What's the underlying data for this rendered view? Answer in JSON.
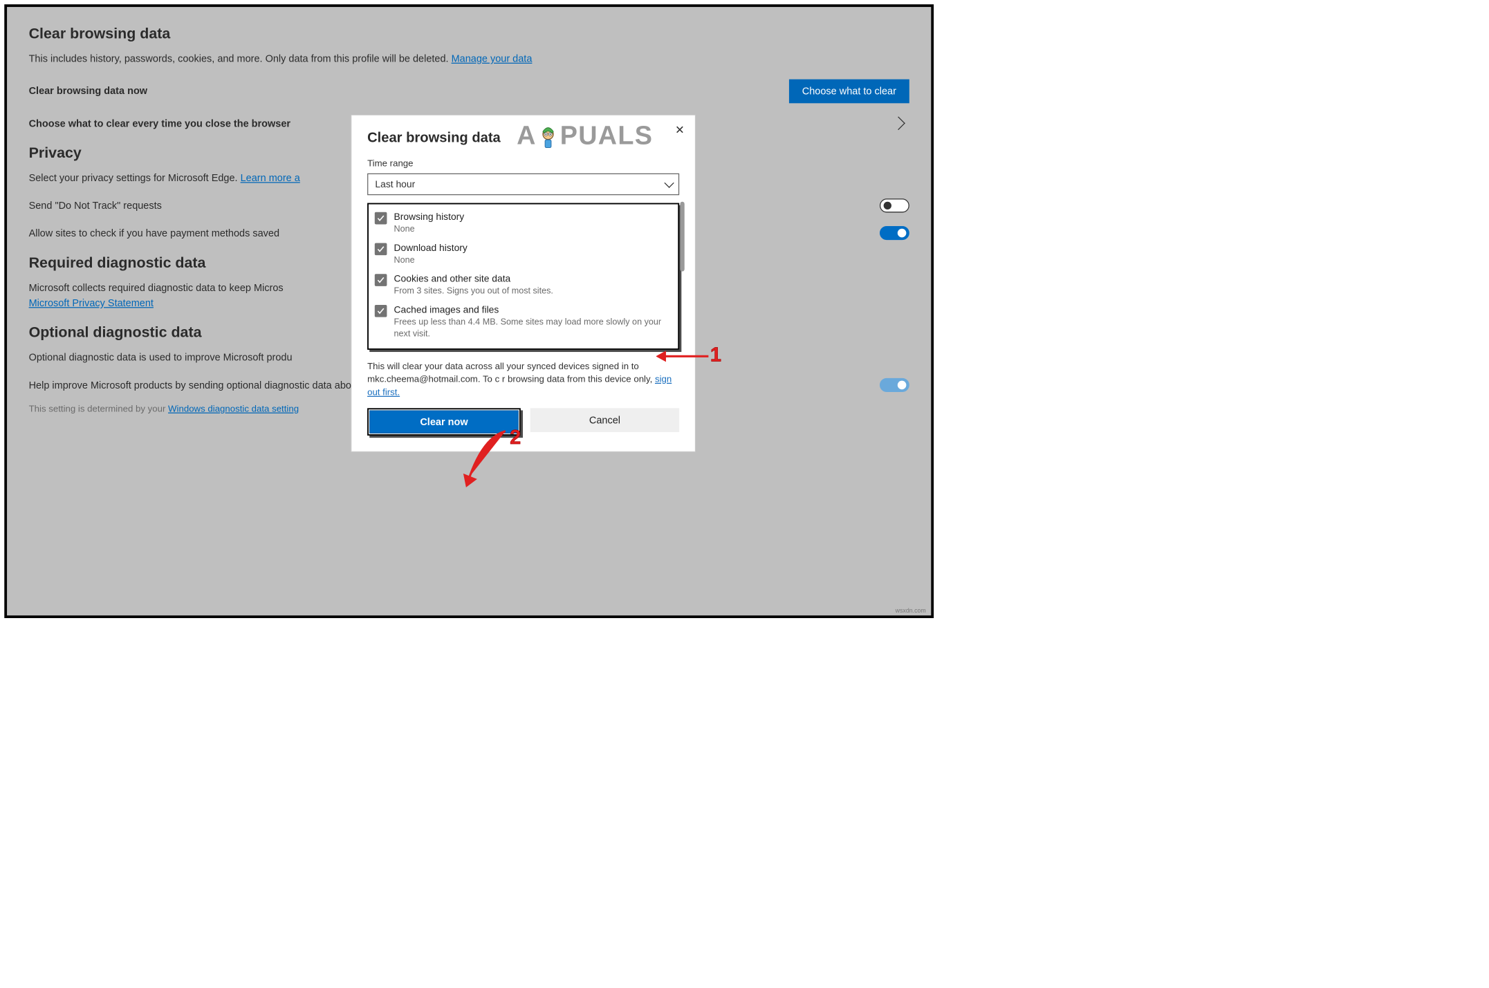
{
  "page": {
    "section_clear": {
      "title": "Clear browsing data",
      "desc_prefix": "This includes history, passwords, cookies, and more. Only data from this profile will be deleted. ",
      "desc_link": "Manage your data",
      "row_now_label": "Clear browsing data now",
      "row_now_button": "Choose what to clear",
      "row_everytime_label": "Choose what to clear every time you close the browser"
    },
    "section_privacy": {
      "title": "Privacy",
      "desc_prefix": "Select your privacy settings for Microsoft Edge. ",
      "desc_link": "Learn more a",
      "row_dnt": "Send \"Do Not Track\" requests",
      "row_payment": "Allow sites to check if you have payment methods saved"
    },
    "section_required": {
      "title": "Required diagnostic data",
      "desc_prefix": "Microsoft collects required diagnostic data to keep Micros",
      "desc_link": "Microsoft Privacy Statement"
    },
    "section_optional": {
      "title": "Optional diagnostic data",
      "desc": "Optional diagnostic data is used to improve Microsoft produ",
      "row_help": "Help improve Microsoft products by sending optional diagnostic data about how you use the browser, websites you visit, and crash reports.",
      "footnote_prefix": "This setting is determined by your ",
      "footnote_link": "Windows diagnostic data setting"
    }
  },
  "dialog": {
    "title": "Clear browsing data",
    "time_range_label": "Time range",
    "time_range_value": "Last hour",
    "items": [
      {
        "title": "Browsing history",
        "sub": "None"
      },
      {
        "title": "Download history",
        "sub": "None"
      },
      {
        "title": "Cookies and other site data",
        "sub": "From 3 sites. Signs you out of most sites."
      },
      {
        "title": "Cached images and files",
        "sub": "Frees up less than 4.4 MB. Some sites may load more slowly on your next visit."
      }
    ],
    "info_prefix": "This will clear your data across all your synced devices signed in to mkc.cheema@hotmail.com. To c    r browsing data from this device only, ",
    "info_link": "sign out first.",
    "btn_clear": "Clear now",
    "btn_cancel": "Cancel"
  },
  "watermark": {
    "left": "A",
    "right": "PUALS"
  },
  "annotations": {
    "one": "1",
    "two": "2"
  },
  "brand": "wsxdn.com"
}
